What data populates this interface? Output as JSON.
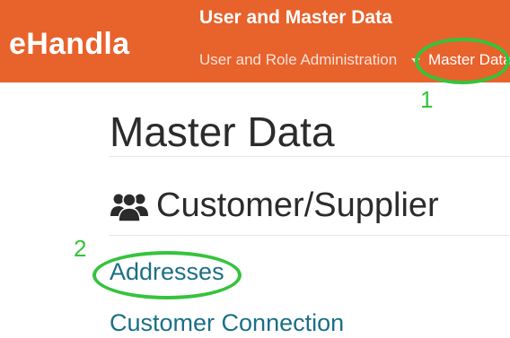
{
  "header": {
    "brand": "eHandla",
    "section_title": "User and Master Data",
    "nav": {
      "dropdown_label": "User and Role Administration",
      "master_data_label": "Master Data"
    },
    "accent_color": "#e8622c"
  },
  "main": {
    "page_title": "Master Data",
    "group": {
      "icon": "users-icon",
      "title": "Customer/Supplier",
      "links": [
        "Addresses",
        "Customer Connection"
      ]
    }
  },
  "annotations": {
    "marker_1": "1",
    "marker_2": "2",
    "color": "#35c33c"
  }
}
